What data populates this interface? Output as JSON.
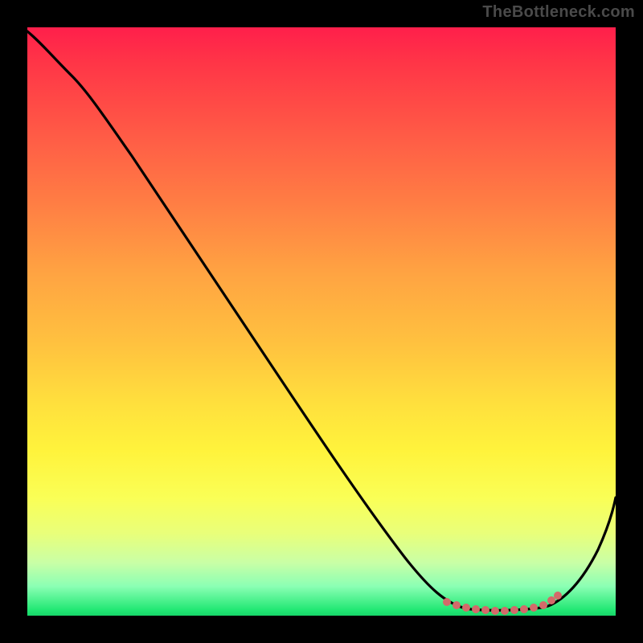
{
  "watermark": "TheBottleneck.com",
  "chart_data": {
    "type": "line",
    "title": "",
    "xlabel": "",
    "ylabel": "",
    "xlim": [
      0,
      100
    ],
    "ylim": [
      0,
      100
    ],
    "series": [
      {
        "name": "bottleneck-curve",
        "color": "#000000",
        "x": [
          0,
          3,
          8,
          14,
          20,
          26,
          32,
          38,
          44,
          50,
          56,
          60,
          64,
          67,
          70,
          72,
          74,
          76,
          78,
          80,
          82,
          84,
          86,
          88,
          90,
          92,
          94,
          96,
          98,
          100
        ],
        "y": [
          99,
          97,
          94,
          90,
          84,
          77,
          70,
          63,
          56,
          48,
          41,
          35,
          29,
          23,
          17,
          12,
          8,
          5,
          3,
          2,
          1.5,
          1.3,
          1.5,
          2.2,
          3.5,
          5.5,
          8.5,
          12.5,
          17.5,
          23
        ]
      },
      {
        "name": "optimal-region-markers",
        "color": "#d36a6a",
        "x": [
          71,
          73,
          74.5,
          76,
          77.5,
          79,
          80.5,
          82,
          83.5,
          85,
          86.5,
          88,
          89.5
        ],
        "y": [
          3.2,
          2.4,
          2.0,
          1.7,
          1.5,
          1.4,
          1.3,
          1.3,
          1.4,
          1.6,
          1.9,
          2.3,
          2.9
        ]
      }
    ],
    "colors": {
      "gradient_top": "#ff1f4b",
      "gradient_mid": "#ffe03d",
      "gradient_bottom": "#17d66a",
      "curve": "#000000",
      "markers": "#d36a6a"
    }
  }
}
